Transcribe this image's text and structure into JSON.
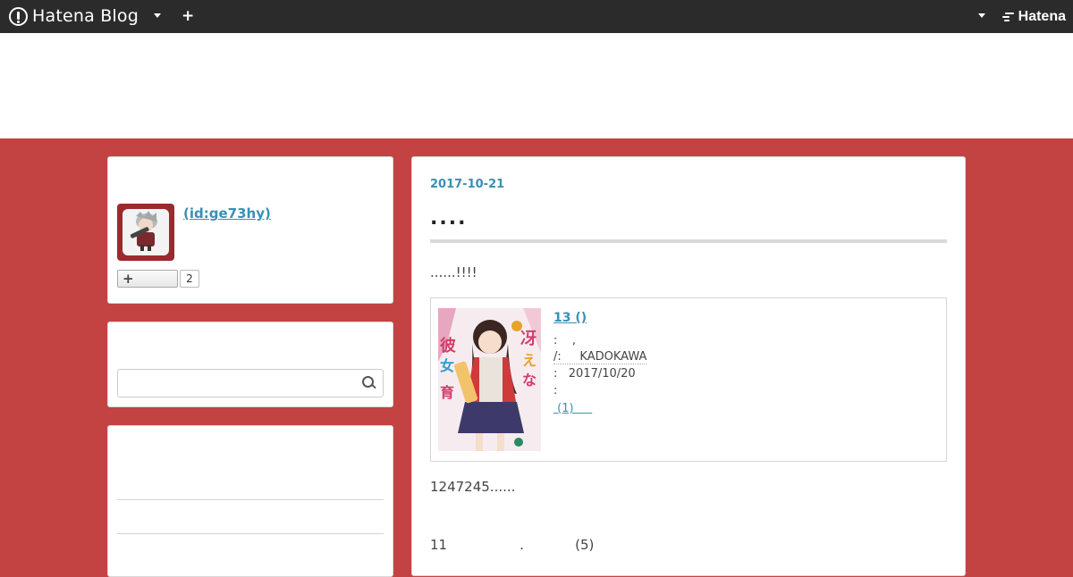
{
  "topbar": {
    "brand": "Hatena Blog",
    "right_brand": "Hatena"
  },
  "profile": {
    "link": " (id:ge73hy)",
    "follow_count": "2"
  },
  "entry": {
    "date": "2017-10-21",
    "title": "....",
    "intro": "......!!!!",
    "paragraph1": "1247245......",
    "paragraph2": "11                 .            (5)"
  },
  "product": {
    "title": "13 ()    ",
    "line1": ":    ,",
    "line2": "/:     KADOKAWA",
    "line3": ":   2017/10/20",
    "line4": ":",
    "review_link": " (1)     "
  },
  "colors": {
    "background": "#c34343",
    "topbar": "#2b2b2b",
    "link": "#3a8fb5"
  },
  "icons": {
    "brand": "hatena-blog-logo-icon",
    "search": "search-icon",
    "plus": "plus-icon",
    "caret": "caret-down-icon"
  }
}
